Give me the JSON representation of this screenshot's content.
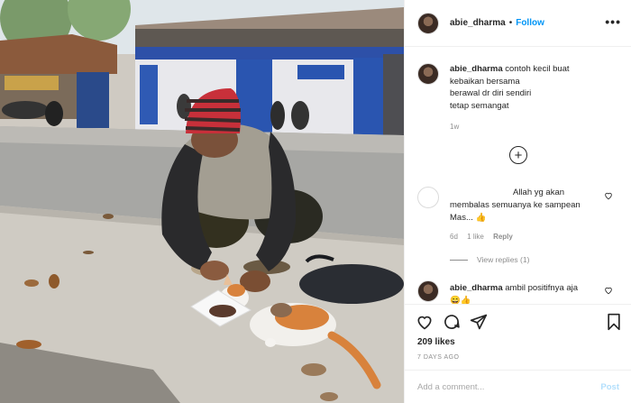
{
  "post": {
    "username": "abie_dharma",
    "separator": "•",
    "follow_label": "Follow",
    "more_label": "•••"
  },
  "caption": {
    "username": "abie_dharma",
    "lines": [
      "contoh kecil buat",
      "kebaikan bersama",
      "berawal dr diri sendiri",
      "tetap semangat"
    ],
    "time": "1w"
  },
  "load_more": "+",
  "comments": [
    {
      "username": "",
      "lines": [
        "Allah yg akan",
        "membalas semuanya ke sampean",
        "Mas... 👍"
      ],
      "time": "6d",
      "likes": "1 like",
      "reply_label": "Reply",
      "view_replies": "View replies (1)"
    },
    {
      "username": "abie_dharma",
      "lines": [
        "ambil positifnya aja",
        "😄👍"
      ]
    }
  ],
  "likes_text": "209 likes",
  "date_text": "7 DAYS AGO",
  "add_comment": {
    "placeholder": "Add a comment...",
    "post_label": "Post"
  },
  "colors": {
    "accent": "#0095f6",
    "muted": "#8e8e8e",
    "post_disabled": "#b2dffc"
  },
  "icons": [
    "heart-icon",
    "comment-icon",
    "share-icon",
    "bookmark-icon",
    "more-icon",
    "plus-circle-icon"
  ]
}
